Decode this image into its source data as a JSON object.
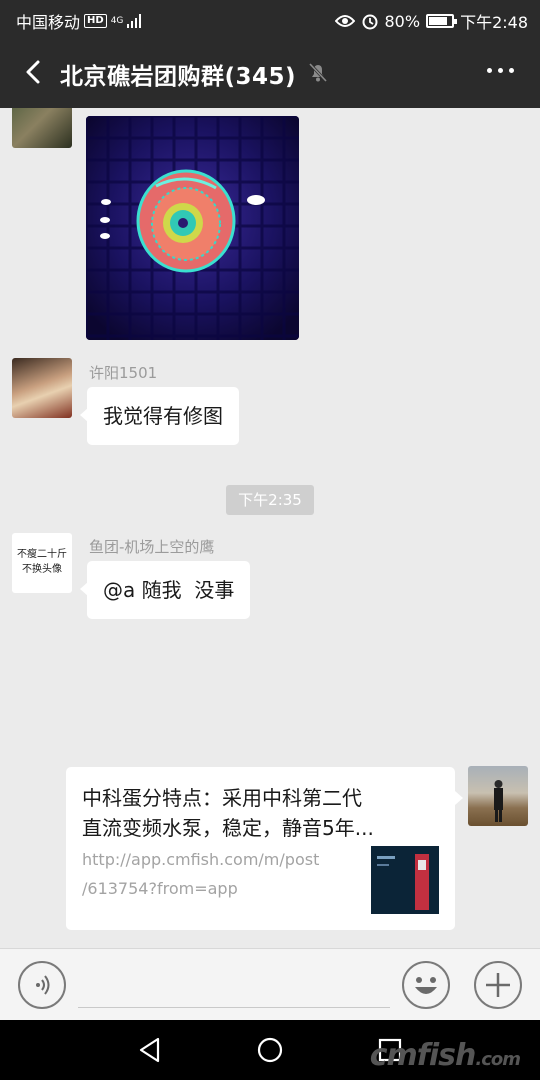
{
  "status_bar": {
    "carrier": "中国移动",
    "hd_badge": "HD",
    "network": "4G",
    "battery_percent": "80%",
    "battery_level": 0.8,
    "time": "下午2:48"
  },
  "header": {
    "title": "北京礁岩团购群(345)",
    "muted": true
  },
  "messages": [
    {
      "type": "image",
      "side": "left",
      "content": "coral-photo"
    },
    {
      "type": "text",
      "side": "left",
      "sender": "许阳1501",
      "text": "我觉得有修图"
    },
    {
      "type": "time",
      "text": "下午2:35"
    },
    {
      "type": "text",
      "side": "left",
      "sender": "鱼团-机场上空的鹰",
      "avatar_text": [
        "不瘦二十斤",
        "不换头像"
      ],
      "text": "@a 随我  没事"
    },
    {
      "type": "link",
      "side": "right",
      "title_lines": [
        "中科蛋分特点：采用中科第二代",
        "直流变频水泵，稳定，静音5年..."
      ],
      "url_lines": [
        "http://app.cmfish.com/m/post",
        "/613754?from=app"
      ]
    }
  ],
  "input_bar": {
    "voice_icon": "voice-icon",
    "emoji_icon": "emoji-icon",
    "plus_icon": "plus-icon"
  },
  "nav_bar": {
    "back": "nav-back-icon",
    "home": "nav-home-icon",
    "recents": "nav-recents-icon"
  },
  "watermark": {
    "main": "cmfish",
    "suffix": ".com"
  },
  "colors": {
    "header_bg": "#2b2b2b",
    "chat_bg": "#ebebeb",
    "bubble_bg": "#ffffff",
    "sender_gray": "#9b9b9b"
  }
}
